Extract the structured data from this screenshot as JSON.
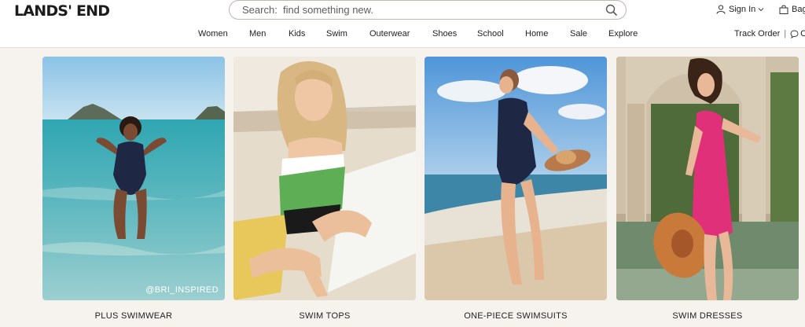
{
  "brand": {
    "logo_text": "LANDS' END"
  },
  "search": {
    "placeholder": "Search:  find something new.",
    "value": ""
  },
  "utility": {
    "sign_in": "Sign In",
    "bag": "Bag"
  },
  "nav": {
    "items": [
      "Women",
      "Men",
      "Kids",
      "Swim",
      "Outerwear",
      "Shoes",
      "School",
      "Home",
      "Sale",
      "Explore"
    ]
  },
  "links": {
    "track_order": "Track Order",
    "separator": "|",
    "chat": "Cl"
  },
  "tiles": [
    {
      "caption": "PLUS SWIMWEAR",
      "handle": "@BRI_INSPIRED"
    },
    {
      "caption": "SWIM TOPS"
    },
    {
      "caption": "ONE-PIECE SWIMSUITS"
    },
    {
      "caption": "SWIM DRESSES"
    }
  ],
  "colors": {
    "page_bg": "#f6f3ef",
    "header_bg": "#ffffff",
    "text": "#1d1d1d",
    "swim_navy": "#1e2744",
    "swim_pink": "#e0307a",
    "swim_green": "#5dae55"
  },
  "icons": [
    "search-icon",
    "user-icon",
    "chevron-down-icon",
    "bag-icon",
    "chat-icon"
  ]
}
